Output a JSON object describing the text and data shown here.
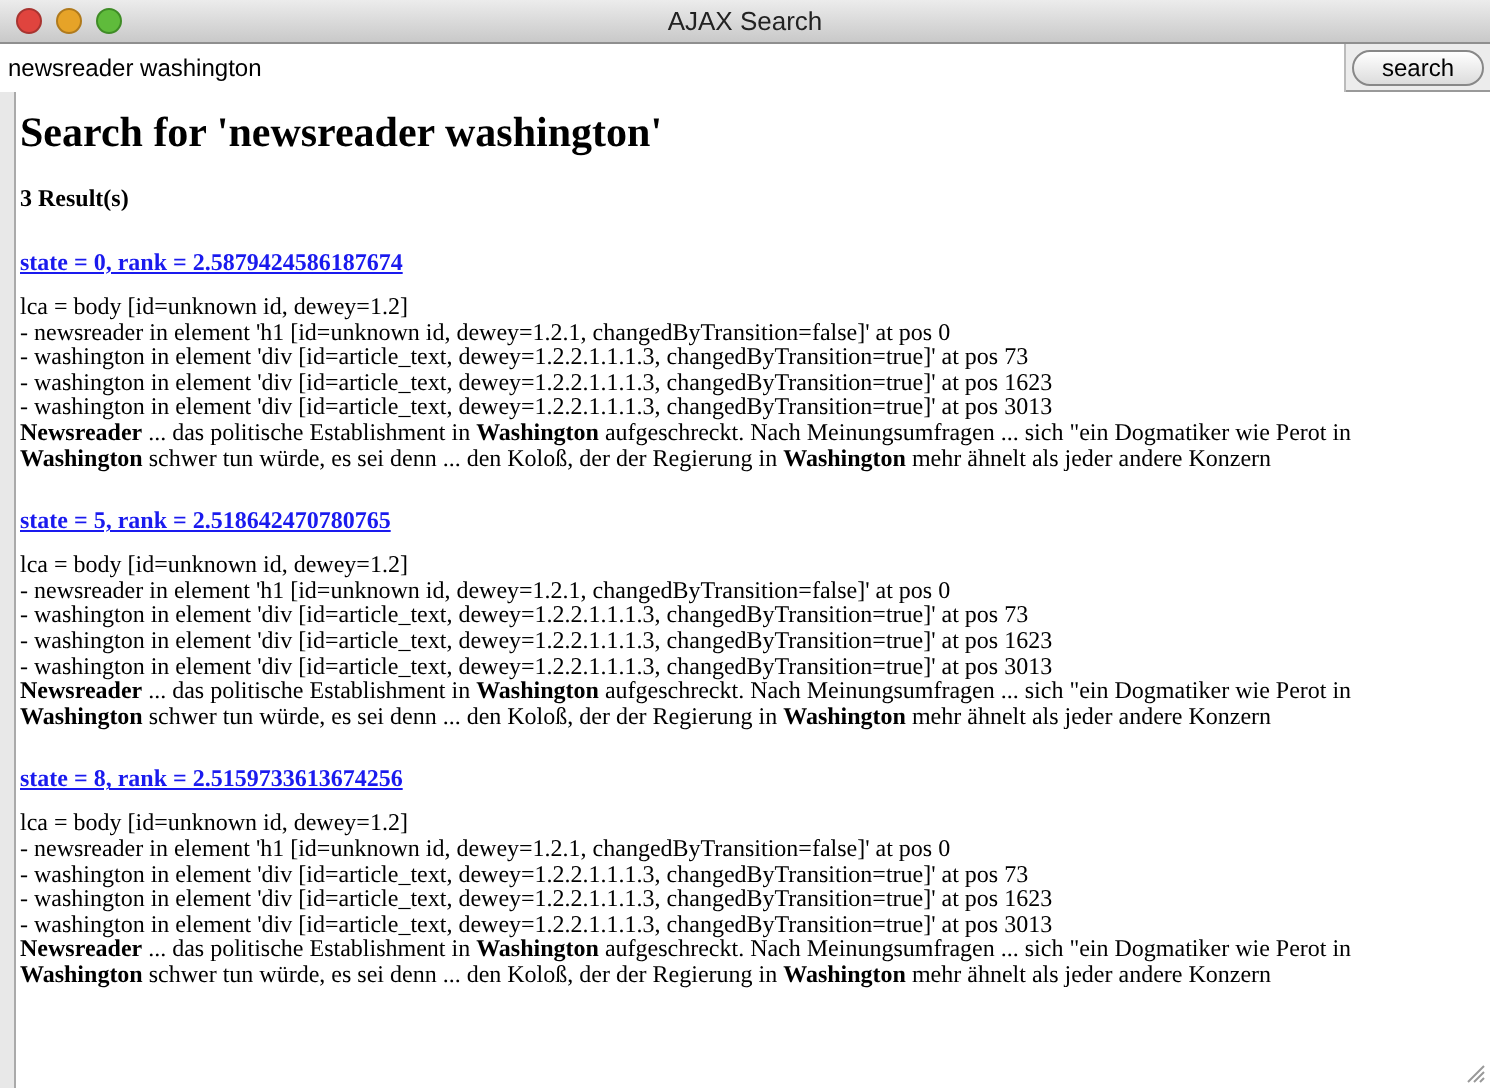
{
  "window": {
    "title": "AJAX Search"
  },
  "search": {
    "value": "newsreader washington",
    "button": "search"
  },
  "heading": "Search for 'newsreader washington'",
  "count": "3 Result(s)",
  "results": [
    {
      "link": "state = 0, rank = 2.5879424586187674",
      "lca": "lca = body [id=unknown id, dewey=1.2]",
      "matches": [
        "- newsreader in element 'h1 [id=unknown id, dewey=1.2.1, changedByTransition=false]' at pos 0",
        "- washington in element 'div [id=article_text, dewey=1.2.2.1.1.1.3, changedByTransition=true]' at pos 73",
        "- washington in element 'div [id=article_text, dewey=1.2.2.1.1.1.3, changedByTransition=true]' at pos 1623",
        "- washington in element 'div [id=article_text, dewey=1.2.2.1.1.1.3, changedByTransition=true]' at pos 3013"
      ],
      "snippet": "**Newsreader** ... das politische Establishment in **Washington** aufgeschreckt. Nach Meinungsumfragen ... sich \"ein Dogmatiker wie Perot in **Washington** schwer tun würde, es sei denn ... den Koloß, der der Regierung in **Washington** mehr ähnelt als jeder andere Konzern"
    },
    {
      "link": "state = 5, rank = 2.518642470780765",
      "lca": "lca = body [id=unknown id, dewey=1.2]",
      "matches": [
        "- newsreader in element 'h1 [id=unknown id, dewey=1.2.1, changedByTransition=false]' at pos 0",
        "- washington in element 'div [id=article_text, dewey=1.2.2.1.1.1.3, changedByTransition=true]' at pos 73",
        "- washington in element 'div [id=article_text, dewey=1.2.2.1.1.1.3, changedByTransition=true]' at pos 1623",
        "- washington in element 'div [id=article_text, dewey=1.2.2.1.1.1.3, changedByTransition=true]' at pos 3013"
      ],
      "snippet": "**Newsreader** ... das politische Establishment in **Washington** aufgeschreckt. Nach Meinungsumfragen ... sich \"ein Dogmatiker wie Perot in **Washington** schwer tun würde, es sei denn ... den Koloß, der der Regierung in **Washington** mehr ähnelt als jeder andere Konzern"
    },
    {
      "link": "state = 8, rank = 2.5159733613674256",
      "lca": "lca = body [id=unknown id, dewey=1.2]",
      "matches": [
        "- newsreader in element 'h1 [id=unknown id, dewey=1.2.1, changedByTransition=false]' at pos 0",
        "- washington in element 'div [id=article_text, dewey=1.2.2.1.1.1.3, changedByTransition=true]' at pos 73",
        "- washington in element 'div [id=article_text, dewey=1.2.2.1.1.1.3, changedByTransition=true]' at pos 1623",
        "- washington in element 'div [id=article_text, dewey=1.2.2.1.1.1.3, changedByTransition=true]' at pos 3013"
      ],
      "snippet": "**Newsreader** ... das politische Establishment in **Washington** aufgeschreckt. Nach Meinungsumfragen ... sich \"ein Dogmatiker wie Perot in **Washington** schwer tun würde, es sei denn ... den Koloß, der der Regierung in **Washington** mehr ähnelt als jeder andere Konzern"
    }
  ]
}
